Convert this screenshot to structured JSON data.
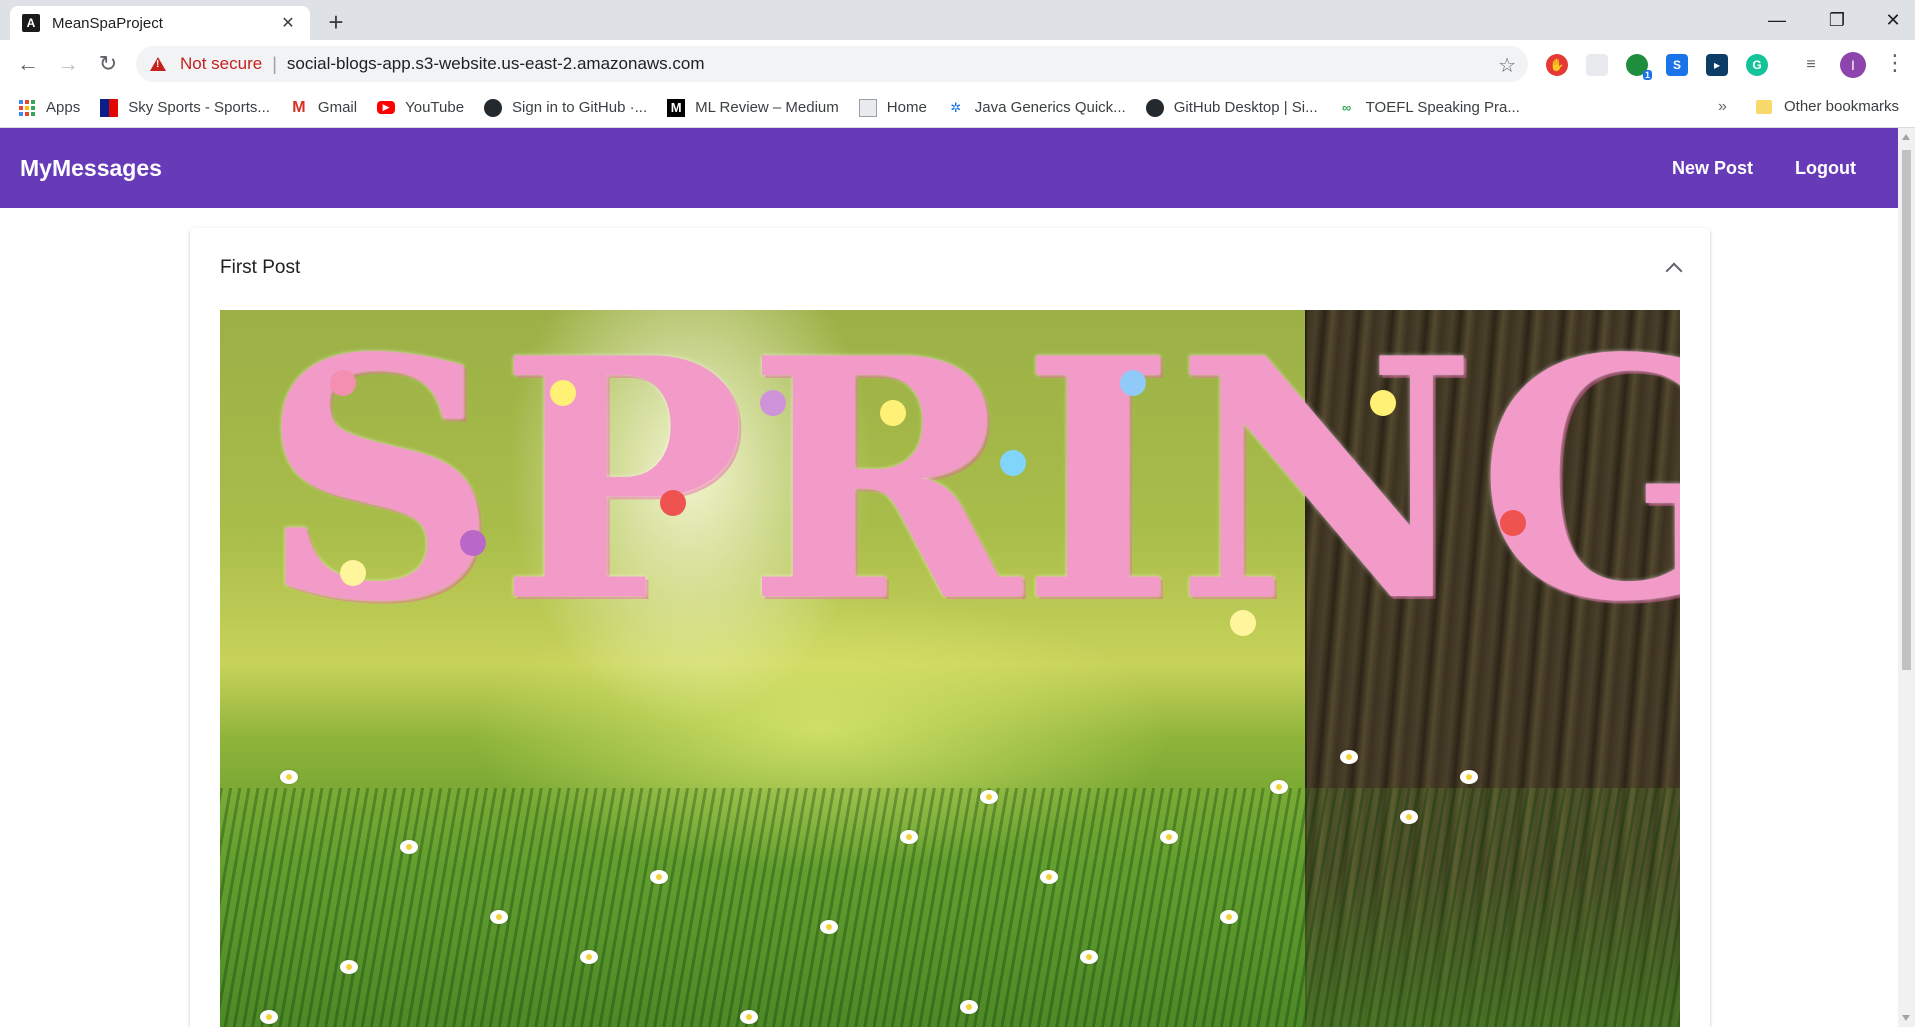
{
  "browser": {
    "tab": {
      "title": "MeanSpaProject",
      "favicon": "A"
    },
    "address": {
      "security_label": "Not secure",
      "url": "social-blogs-app.s3-website.us-east-2.amazonaws.com"
    },
    "profile_initial": "I",
    "bookmarks": [
      {
        "label": "Apps",
        "icon": "apps-grid-icon"
      },
      {
        "label": "Sky Sports - Sports...",
        "icon": "sky-sports-icon"
      },
      {
        "label": "Gmail",
        "icon": "gmail-icon"
      },
      {
        "label": "YouTube",
        "icon": "youtube-icon"
      },
      {
        "label": "Sign in to GitHub ·...",
        "icon": "github-icon"
      },
      {
        "label": "ML Review – Medium",
        "icon": "medium-icon"
      },
      {
        "label": "Home",
        "icon": "page-icon"
      },
      {
        "label": "Java Generics Quick...",
        "icon": "java-icon"
      },
      {
        "label": "GitHub Desktop | Si...",
        "icon": "github-icon"
      },
      {
        "label": "TOEFL Speaking Pra...",
        "icon": "toefl-icon"
      }
    ],
    "more_bookmarks": "»",
    "other_bookmarks": "Other bookmarks",
    "extension_badge": "1",
    "extension_s_label": "S",
    "extension_g_label": "G"
  },
  "app": {
    "title": "MyMessages",
    "nav": {
      "new_post": "New Post",
      "logout": "Logout"
    },
    "posts": [
      {
        "title": "First Post",
        "image_text": [
          "S",
          "P",
          "R",
          "I",
          "N",
          "G"
        ]
      }
    ]
  },
  "colors": {
    "app_bar": "#673ab7",
    "not_secure": "#c5221f"
  }
}
